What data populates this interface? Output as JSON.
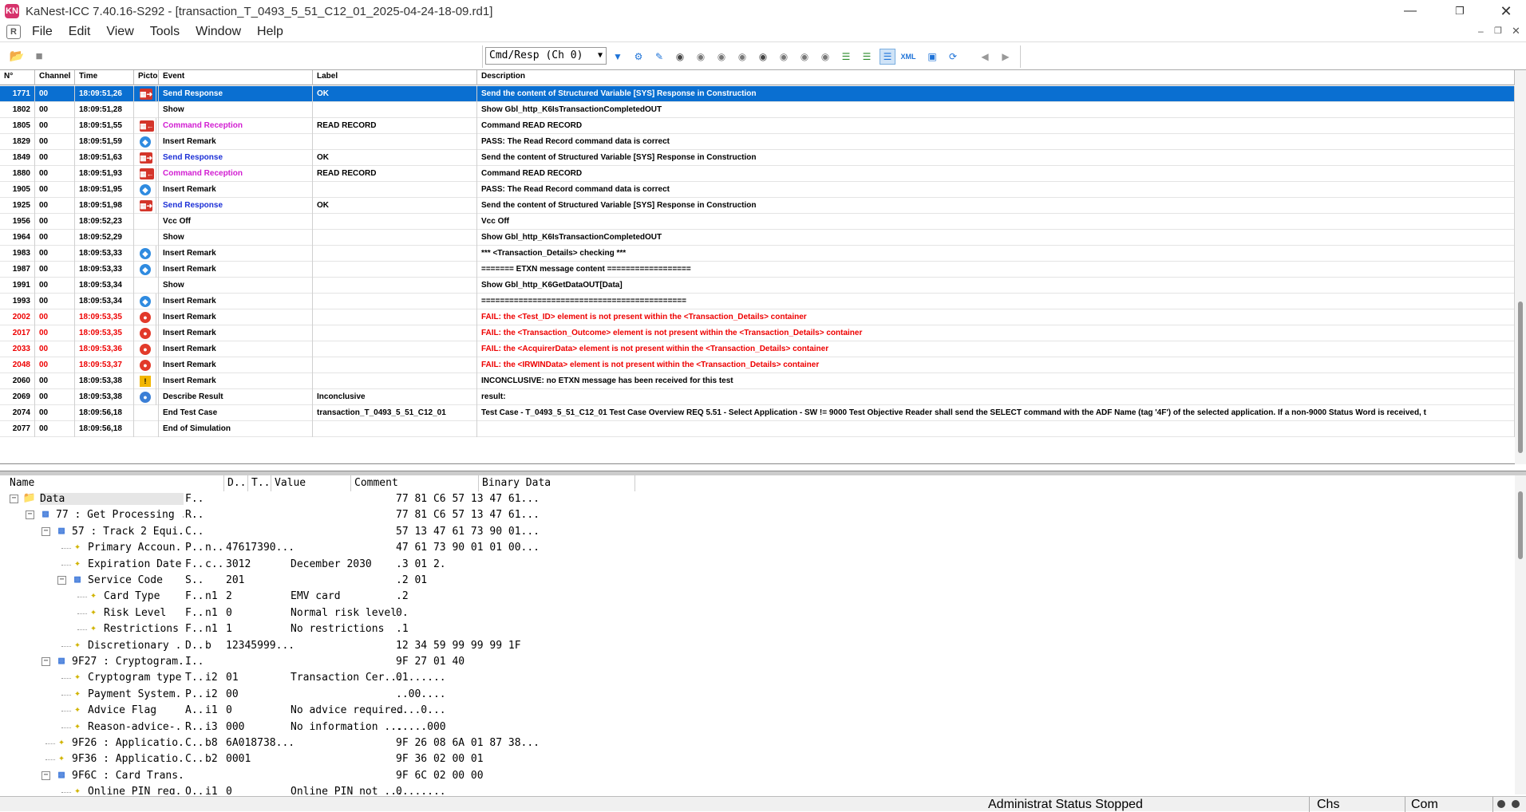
{
  "window": {
    "title": "KaNest-ICC 7.40.16-S292 - [transaction_T_0493_5_51_C12_01_2025-04-24-18-09.rd1]",
    "app_icon": "KN"
  },
  "menu": {
    "mdi_icon": "R",
    "items": [
      "File",
      "Edit",
      "View",
      "Tools",
      "Window",
      "Help"
    ]
  },
  "toolbar": {
    "channel_select": "Cmd/Resp (Ch 0)"
  },
  "events": {
    "headers": [
      "N°",
      "Channel",
      "Time",
      "Picto",
      "Event",
      "Label",
      "Description"
    ],
    "rows": [
      {
        "n": "1771",
        "ch": "00",
        "time": "18:09:51,26",
        "picto": "send",
        "event": "Send Response",
        "label": "OK",
        "desc": "Send the content of Structured Variable [SYS] Response in Construction",
        "style": "sel"
      },
      {
        "n": "1802",
        "ch": "00",
        "time": "18:09:51,28",
        "picto": "",
        "event": "Show",
        "label": "",
        "desc": "Show Gbl_http_K6IsTransactionCompletedOUT",
        "style": ""
      },
      {
        "n": "1805",
        "ch": "00",
        "time": "18:09:51,55",
        "picto": "recv",
        "event": "Command Reception",
        "label": "READ RECORD",
        "desc": "Command READ RECORD",
        "style": "cmd"
      },
      {
        "n": "1829",
        "ch": "00",
        "time": "18:09:51,59",
        "picto": "info",
        "event": "Insert Remark",
        "label": "",
        "desc": "PASS: The Read Record command data is correct",
        "style": ""
      },
      {
        "n": "1849",
        "ch": "00",
        "time": "18:09:51,63",
        "picto": "send",
        "event": "Send Response",
        "label": "OK",
        "desc": "Send the content of Structured Variable [SYS] Response in Construction",
        "style": "resp"
      },
      {
        "n": "1880",
        "ch": "00",
        "time": "18:09:51,93",
        "picto": "recv",
        "event": "Command Reception",
        "label": "READ RECORD",
        "desc": "Command READ RECORD",
        "style": "cmd"
      },
      {
        "n": "1905",
        "ch": "00",
        "time": "18:09:51,95",
        "picto": "info",
        "event": "Insert Remark",
        "label": "",
        "desc": "PASS: The Read Record command data is correct",
        "style": ""
      },
      {
        "n": "1925",
        "ch": "00",
        "time": "18:09:51,98",
        "picto": "send",
        "event": "Send Response",
        "label": "OK",
        "desc": "Send the content of Structured Variable [SYS] Response in Construction",
        "style": "resp"
      },
      {
        "n": "1956",
        "ch": "00",
        "time": "18:09:52,23",
        "picto": "",
        "event": "Vcc Off",
        "label": "",
        "desc": "Vcc Off",
        "style": ""
      },
      {
        "n": "1964",
        "ch": "00",
        "time": "18:09:52,29",
        "picto": "",
        "event": "Show",
        "label": "",
        "desc": "Show Gbl_http_K6IsTransactionCompletedOUT",
        "style": ""
      },
      {
        "n": "1983",
        "ch": "00",
        "time": "18:09:53,33",
        "picto": "info",
        "event": "Insert Remark",
        "label": "",
        "desc": "*** <Transaction_Details> checking ***",
        "style": ""
      },
      {
        "n": "1987",
        "ch": "00",
        "time": "18:09:53,33",
        "picto": "info",
        "event": "Insert Remark",
        "label": "",
        "desc": "======= ETXN message content ==================",
        "style": ""
      },
      {
        "n": "1991",
        "ch": "00",
        "time": "18:09:53,34",
        "picto": "",
        "event": "Show",
        "label": "",
        "desc": "Show Gbl_http_K6GetDataOUT[Data]",
        "style": ""
      },
      {
        "n": "1993",
        "ch": "00",
        "time": "18:09:53,34",
        "picto": "info",
        "event": "Insert Remark",
        "label": "",
        "desc": "============================================",
        "style": ""
      },
      {
        "n": "2002",
        "ch": "00",
        "time": "18:09:53,35",
        "picto": "fail",
        "event": "Insert Remark",
        "label": "",
        "desc": "FAIL: the <Test_ID> element is not present within the <Transaction_Details> container",
        "style": "red"
      },
      {
        "n": "2017",
        "ch": "00",
        "time": "18:09:53,35",
        "picto": "fail",
        "event": "Insert Remark",
        "label": "",
        "desc": "FAIL: the <Transaction_Outcome> element is not present within the <Transaction_Details> container",
        "style": "red"
      },
      {
        "n": "2033",
        "ch": "00",
        "time": "18:09:53,36",
        "picto": "fail",
        "event": "Insert Remark",
        "label": "",
        "desc": "FAIL: the <AcquirerData> element is not present within the <Transaction_Details> container",
        "style": "red"
      },
      {
        "n": "2048",
        "ch": "00",
        "time": "18:09:53,37",
        "picto": "fail",
        "event": "Insert Remark",
        "label": "",
        "desc": "FAIL: the <IRWINData> element is not present within the <Transaction_Details> container",
        "style": "red"
      },
      {
        "n": "2060",
        "ch": "00",
        "time": "18:09:53,38",
        "picto": "warn",
        "event": "Insert Remark",
        "label": "",
        "desc": "INCONCLUSIVE: no ETXN message has been received for this test",
        "style": ""
      },
      {
        "n": "2069",
        "ch": "00",
        "time": "18:09:53,38",
        "picto": "result",
        "event": "Describe Result",
        "label": "Inconclusive",
        "desc": " result:",
        "style": ""
      },
      {
        "n": "2074",
        "ch": "00",
        "time": "18:09:56,18",
        "picto": "",
        "event": "End Test Case",
        "label": "transaction_T_0493_5_51_C12_01",
        "desc": "Test Case - T_0493_5_51_C12_01  Test Case Overview       REQ 5.51 - Select Application - SW != 9000          Test Objective        Reader shall send the SELECT command with the ADF Name (tag '4F') of the selected application. If a non-9000 Status Word is received, t",
        "style": ""
      },
      {
        "n": "2077",
        "ch": "00",
        "time": "18:09:56,18",
        "picto": "",
        "event": "End of Simulation",
        "label": "",
        "desc": "",
        "style": ""
      }
    ]
  },
  "tree": {
    "headers": [
      "Name",
      "D..",
      "T..",
      "Value",
      "Comment",
      "Binary Data"
    ],
    "rows": [
      {
        "level": 0,
        "icon": "folder",
        "toggle": "minus",
        "name": "Data",
        "d": "F..",
        "t": "",
        "value": "",
        "comment": "",
        "bin": "77 81 C6 57 13 47 61..."
      },
      {
        "level": 1,
        "icon": "struct",
        "toggle": "minus",
        "name": "77 : Get Processing ...",
        "d": "R..",
        "t": "",
        "value": "",
        "comment": "",
        "bin": "77 81 C6 57 13 47 61..."
      },
      {
        "level": 2,
        "icon": "struct",
        "toggle": "minus",
        "name": "57 : Track 2 Equi...",
        "d": "C..",
        "t": "",
        "value": "",
        "comment": "",
        "bin": "57 13 47 61 73 90 01..."
      },
      {
        "level": 3,
        "icon": "leaf",
        "toggle": "",
        "name": "Primary Accoun...",
        "d": "P..",
        "t": "n..",
        "value": "47617390...",
        "comment": "",
        "bin": "47 61 73 90 01 01 00..."
      },
      {
        "level": 3,
        "icon": "leaf",
        "toggle": "",
        "name": "Expiration Date",
        "d": "F..",
        "t": "c..",
        "value": "3012",
        "comment": "December 2030",
        "bin": ".3 01 2."
      },
      {
        "level": 3,
        "icon": "struct2",
        "toggle": "minus",
        "name": "Service Code",
        "d": "S..",
        "t": "",
        "value": "201",
        "comment": "",
        "bin": ".2 01"
      },
      {
        "level": 4,
        "icon": "leaf",
        "toggle": "",
        "name": "Card Type",
        "d": "F..",
        "t": "n1",
        "value": "2",
        "comment": "EMV card",
        "bin": ".2"
      },
      {
        "level": 4,
        "icon": "leaf",
        "toggle": "",
        "name": "Risk Level",
        "d": "F..",
        "t": "n1",
        "value": "0",
        "comment": "Normal risk level",
        "bin": "0."
      },
      {
        "level": 4,
        "icon": "leaf",
        "toggle": "",
        "name": "Restrictions",
        "d": "F..",
        "t": "n1",
        "value": "1",
        "comment": "No restrictions",
        "bin": ".1"
      },
      {
        "level": 3,
        "icon": "leaf",
        "toggle": "",
        "name": "Discretionary ...",
        "d": "D..",
        "t": "b",
        "value": "12345999...",
        "comment": "",
        "bin": "12 34 59 99 99 99 1F"
      },
      {
        "level": 2,
        "icon": "struct",
        "toggle": "minus",
        "name": "9F27 : Cryptogram...",
        "d": "I..",
        "t": "",
        "value": "",
        "comment": "",
        "bin": "9F 27 01 40"
      },
      {
        "level": 3,
        "icon": "leaf",
        "toggle": "",
        "name": "Cryptogram type",
        "d": "T..",
        "t": "i2",
        "value": "01",
        "comment": "Transaction Cer...",
        "bin": "01......"
      },
      {
        "level": 3,
        "icon": "leaf",
        "toggle": "",
        "name": "Payment System...",
        "d": "P..",
        "t": "i2",
        "value": "00",
        "comment": "",
        "bin": "..00...."
      },
      {
        "level": 3,
        "icon": "leaf",
        "toggle": "",
        "name": "Advice Flag",
        "d": "A..",
        "t": "i1",
        "value": "0",
        "comment": "No advice required",
        "bin": "....0..."
      },
      {
        "level": 3,
        "icon": "leaf",
        "toggle": "",
        "name": "Reason-advice-...",
        "d": "R..",
        "t": "i3",
        "value": "000",
        "comment": "No information ...",
        "bin": ".....000"
      },
      {
        "level": 2,
        "icon": "struct3",
        "toggle": "",
        "name": "9F26 : Applicatio...",
        "d": "C..",
        "t": "b8",
        "value": "6A018738...",
        "comment": "",
        "bin": "9F 26 08 6A 01 87 38..."
      },
      {
        "level": 2,
        "icon": "struct3",
        "toggle": "",
        "name": "9F36 : Applicatio...",
        "d": "C..",
        "t": "b2",
        "value": "0001",
        "comment": "",
        "bin": "9F 36 02 00 01"
      },
      {
        "level": 2,
        "icon": "struct",
        "toggle": "minus",
        "name": "9F6C : Card Trans...",
        "d": "",
        "t": "",
        "value": "",
        "comment": "",
        "bin": "9F 6C 02 00 00"
      },
      {
        "level": 3,
        "icon": "leaf",
        "toggle": "",
        "name": "Online PIN req...",
        "d": "O..",
        "t": "i1",
        "value": "0",
        "comment": "Online PIN not ...",
        "bin": "0......."
      }
    ]
  },
  "status": {
    "admin": "Administrat Status  Stopped",
    "chs": "Chs",
    "com": "Com"
  }
}
